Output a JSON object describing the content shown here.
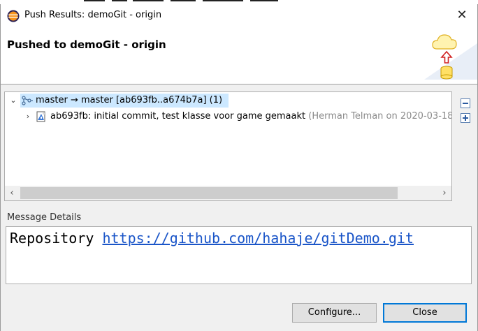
{
  "window": {
    "title": "Push Results: demoGit - origin",
    "close_glyph": "✕"
  },
  "banner": {
    "title": "Pushed to demoGit - origin",
    "icon": "cloud-push-icon"
  },
  "tree": {
    "rows": [
      {
        "expanded": true,
        "twisty": "⌄",
        "icon": "branch-icon",
        "label": "master → master [ab693fb..a674b7a] (1)",
        "selected": true
      },
      {
        "expanded": false,
        "twisty": "›",
        "icon": "commit-icon",
        "label": "ab693fb: initial commit, test klasse voor game gemaakt",
        "meta": " (Herman Telman on 2020-03-18"
      }
    ],
    "scroll_left": "‹",
    "scroll_right": "›"
  },
  "side_buttons": {
    "collapse": "collapse-all-icon",
    "expand": "expand-all-icon"
  },
  "message": {
    "label": "Message Details",
    "prefix": "Repository ",
    "link": "https://github.com/hahaje/gitDemo.git"
  },
  "buttons": {
    "configure": "Configure...",
    "close": "Close"
  },
  "colors": {
    "selection": "#cce8ff",
    "link": "#1a55c8",
    "default_button_border": "#0078d7"
  }
}
